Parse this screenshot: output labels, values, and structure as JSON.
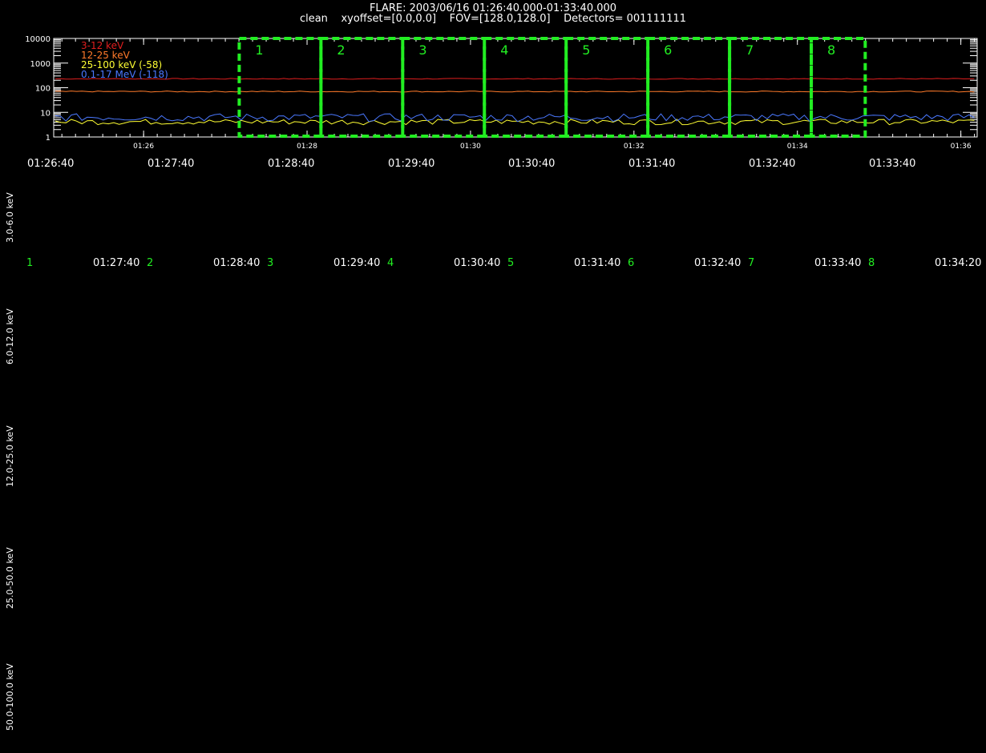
{
  "header": {
    "line1": "FLARE: 2003/06/16 01:26:40.000-01:33:40.000",
    "line2": "clean    xyoffset=[0.0,0.0]    FOV=[128.0,128.0]    Detectors= 001111111"
  },
  "chart_data": {
    "type": "line",
    "yscale": "log",
    "ylim": [
      1,
      10000
    ],
    "y_tick_labels": [
      "1",
      "10",
      "100",
      "1000",
      "10000"
    ],
    "x_tick_labels": [
      "01:26",
      "01:28",
      "01:30",
      "01:32",
      "01:34",
      "01:36"
    ],
    "x_tick_minutes": [
      26,
      28,
      30,
      32,
      34,
      36
    ],
    "xlim_minutes": [
      24.9,
      36.2
    ],
    "legend_position": "top-left",
    "series": [
      {
        "name": "3-12 keV",
        "color": "#e01e1e",
        "level": 230,
        "noise": 0.04
      },
      {
        "name": "12-25 keV",
        "color": "#ff7a2a",
        "level": 70,
        "noise": 0.05
      },
      {
        "name": "25-100 keV (-58)",
        "color": "#ffff33",
        "level": 4.2,
        "noise": 0.25
      },
      {
        "name": "0.1-17 MeV (-118)",
        "color": "#4a78ff",
        "level": 6.5,
        "noise": 0.35
      }
    ],
    "intervals": [
      {
        "label": "1",
        "start": 27.17,
        "end": 28.17
      },
      {
        "label": "2",
        "start": 28.17,
        "end": 29.17
      },
      {
        "label": "3",
        "start": 29.17,
        "end": 30.17
      },
      {
        "label": "4",
        "start": 30.17,
        "end": 31.17
      },
      {
        "label": "5",
        "start": 31.17,
        "end": 32.17
      },
      {
        "label": "6",
        "start": 32.17,
        "end": 33.17
      },
      {
        "label": "7",
        "start": 33.17,
        "end": 34.17
      },
      {
        "label": "8",
        "start": 34.17,
        "end": 34.83
      }
    ],
    "interval_color": "#22ee22"
  },
  "time_axis": [
    "01:26:40",
    "01:27:40",
    "01:28:40",
    "01:29:40",
    "01:30:40",
    "01:31:40",
    "01:32:40",
    "01:33:40"
  ],
  "grid_row": {
    "numbers": [
      "1",
      "2",
      "3",
      "4",
      "5",
      "6",
      "7",
      "8"
    ],
    "times": [
      "01:27:40",
      "01:28:40",
      "01:29:40",
      "01:30:40",
      "01:31:40",
      "01:32:40",
      "01:33:40",
      "01:34:20"
    ]
  },
  "energy_bands": [
    "3.0-6.0 keV",
    "6.0-12.0 keV",
    "12.0-25.0 keV",
    "25.0-50.0 keV",
    "50.0-100.0 keV"
  ]
}
